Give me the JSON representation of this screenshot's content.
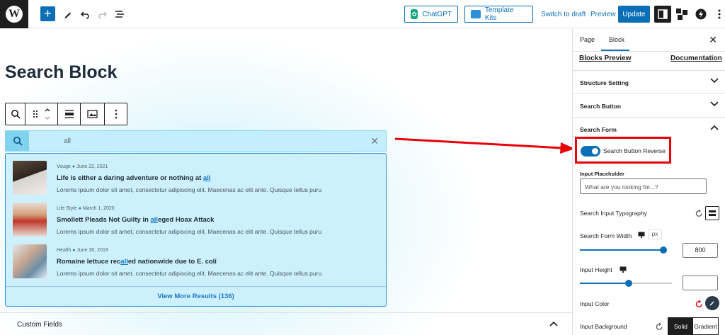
{
  "topbar": {
    "chatgpt_label": "ChatGPT",
    "template_kits_label": "Template Kits",
    "switch_to_draft": "Switch to draft",
    "preview": "Preview",
    "update": "Update"
  },
  "canvas": {
    "page_title": "Search Block",
    "search": {
      "value": "all",
      "view_more_label": "View More Results (136)",
      "results": [
        {
          "category": "Vouge",
          "date": "June 22, 2021",
          "title_before": "Life is either a daring adventure or nothing at ",
          "title_match": "all",
          "title_after": "",
          "excerpt": "Lorems ipsum dolor sit amet, consectetur adipiscing elit. Maecenas ac elit ante. Quisque tellus puru"
        },
        {
          "category": "Life Style",
          "date": "March 1, 2020",
          "title_before": "Smollett Pleads Not Guilty in ",
          "title_match": "all",
          "title_after": "eged Hoax Attack",
          "excerpt": "Lorems ipsum dolor sit amet, consectetur adipiscing elit. Maecenas ac elit ante. Quisque tellus puru"
        },
        {
          "category": "Health",
          "date": "June 30, 2019",
          "title_before": "Romaine lettuce rec",
          "title_match": "all",
          "title_after": "ed nationwide due to E. coli",
          "excerpt": "Lorems ipsum dolor sit amet, consectetur adipiscing elit. Maecenas ac elit ante. Quisque tellus puru"
        }
      ]
    },
    "custom_fields_label": "Custom Fields"
  },
  "sidebar": {
    "tabs": [
      "Page",
      "Block"
    ],
    "active_tab": "Block",
    "blocks_preview": "Blocks Preview",
    "documentation": "Documentation",
    "panels": {
      "structure": "Structure Setting",
      "search_button": "Search Button",
      "search_form": "Search Form"
    },
    "toggle_label": "Search Button Reverse",
    "toggle_on": true,
    "input_placeholder_label": "Input Placeholder",
    "input_placeholder_value": "What are you looking for...?",
    "typography_label": "Search Input Typography",
    "form_width_label": "Search Form Width",
    "form_width_unit": "px",
    "form_width_value": "800",
    "input_height_label": "Input Height",
    "input_height_value": "",
    "input_color_label": "Input Color",
    "input_background_label": "Input Background",
    "bg_options": [
      "Solid",
      "Gradient"
    ],
    "bg_active": "Solid"
  },
  "colors": {
    "accent": "#0b6fb8",
    "highlight": "#e8000b",
    "dark": "#1e1e1e"
  }
}
